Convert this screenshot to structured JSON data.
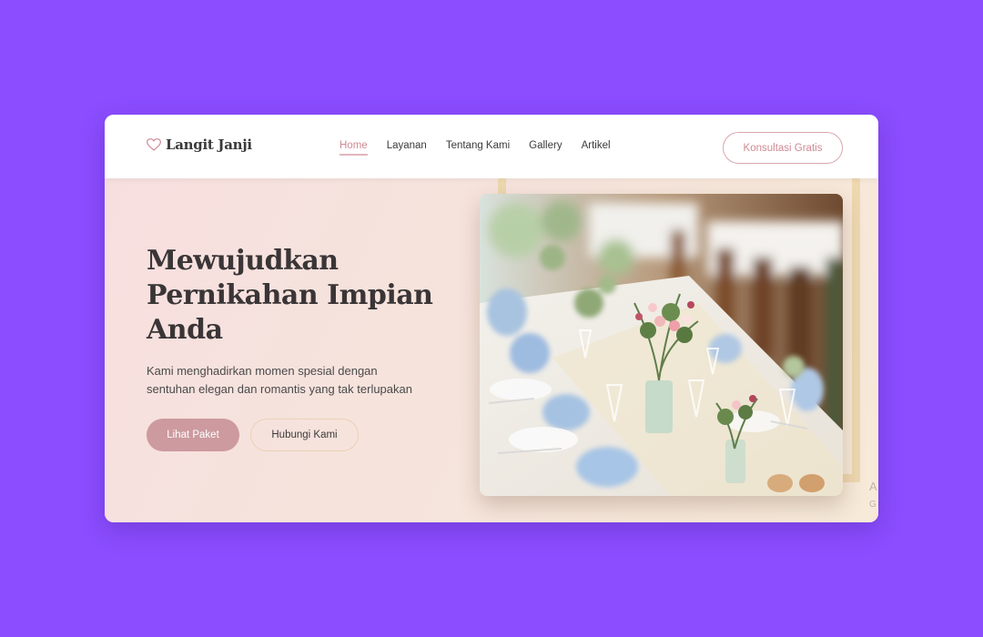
{
  "brand": {
    "name": "Langit Janji",
    "icon": "heart-outline-icon",
    "accent": "#cf8a93"
  },
  "nav": {
    "items": [
      {
        "label": "Home",
        "active": true
      },
      {
        "label": "Layanan",
        "active": false
      },
      {
        "label": "Tentang Kami",
        "active": false
      },
      {
        "label": "Gallery",
        "active": false
      },
      {
        "label": "Artikel",
        "active": false
      }
    ],
    "cta_label": "Konsultasi Gratis"
  },
  "hero": {
    "title_line1": "Mewujudkan",
    "title_line2": "Pernikahan Impian",
    "title_line3": "Anda",
    "subtitle_line1": "Kami menghadirkan momen spesial dengan",
    "subtitle_line2": "sentuhan elegan dan romantis yang tak terlupakan",
    "primary_button": "Lihat Paket",
    "secondary_button": "Hubungi Kami",
    "image": "wedding-table-floral-photo",
    "edge_letter_1": "A",
    "edge_letter_2": "G"
  },
  "colors": {
    "page_background": "#8b4dff",
    "primary_button": "#cc9a9f",
    "frame": "#eed8b0"
  }
}
